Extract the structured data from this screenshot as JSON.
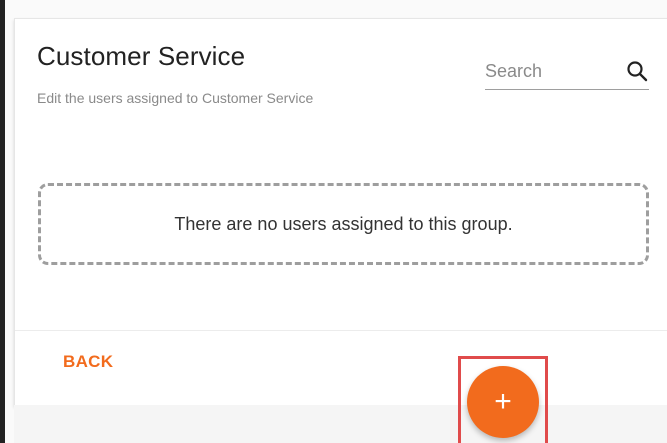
{
  "group": {
    "title": "Customer Service",
    "subtitle": "Edit the users assigned to Customer Service"
  },
  "search": {
    "placeholder": "Search",
    "icon": "search-icon"
  },
  "users": {
    "empty_message": "There are no users assigned to this group."
  },
  "actions": {
    "back_label": "BACK",
    "add_label": "+"
  },
  "colors": {
    "accent": "#f26b1d",
    "highlight": "#e04b4b"
  }
}
